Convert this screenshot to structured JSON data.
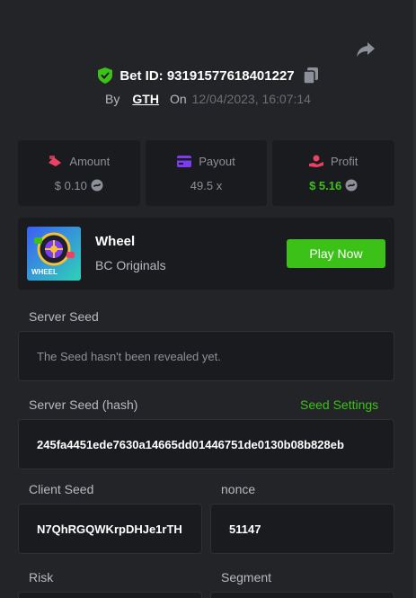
{
  "bet": {
    "id_label": "Bet ID: 93191577618401227",
    "by_label": "By",
    "user": "GTH",
    "on_label": "On",
    "date": "12/04/2023, 16:07:14"
  },
  "stats": [
    {
      "label": "Amount",
      "value": "$ 0.10",
      "icon": "amount-icon",
      "color": "#ed4163"
    },
    {
      "label": "Payout",
      "value": "49.5 x",
      "icon": "payout-card-icon",
      "color": "#7d3cf2"
    },
    {
      "label": "Profit",
      "value": "$ 5.16",
      "icon": "profit-icon",
      "color": "#ed4163"
    }
  ],
  "game": {
    "name": "Wheel",
    "provider": "BC Originals",
    "thumb_text": "WHEEL",
    "play_label": "Play Now"
  },
  "fields": {
    "server_seed_label": "Server Seed",
    "server_seed_value": "The Seed hasn't been revealed yet.",
    "server_hash_label": "Server Seed (hash)",
    "seed_settings_label": "Seed Settings",
    "server_hash_value": "245fa4451ede7630a14665dd01446751de0130b08b828eb",
    "client_seed_label": "Client Seed",
    "client_seed_value": "N7QhRGQWKrpDHJe1rTH",
    "nonce_label": "nonce",
    "nonce_value": "51147",
    "risk_label": "Risk",
    "segment_label": "Segment"
  },
  "colors": {
    "accent_green": "#3bc117",
    "background": "#232427",
    "card": "#1a1b1e"
  }
}
